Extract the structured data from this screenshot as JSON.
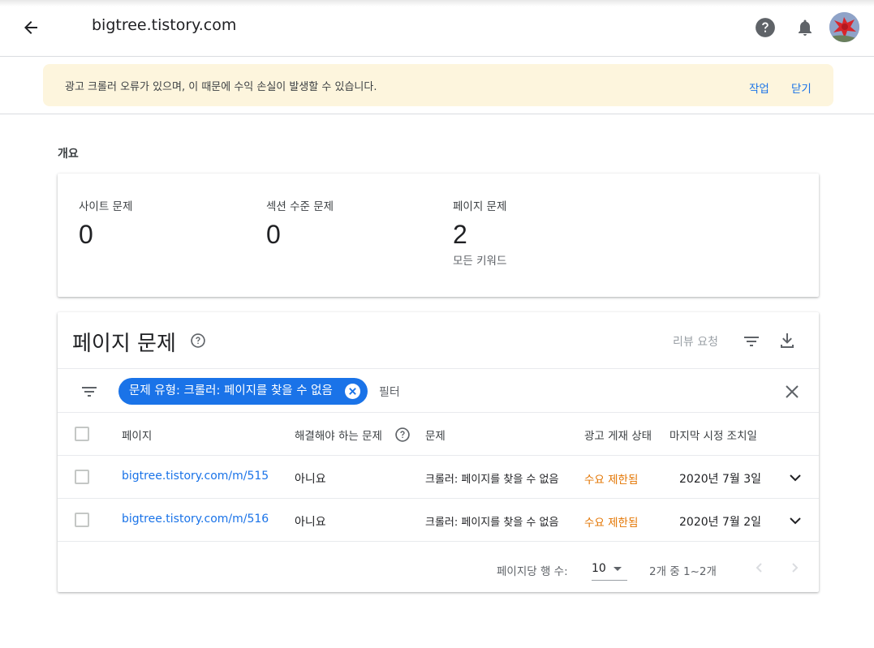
{
  "header": {
    "site": "bigtree.tistory.com",
    "back_icon": "arrow-back-icon",
    "help_icon": "help-icon",
    "notifications_icon": "bell-icon"
  },
  "banner": {
    "message": "광고 크롤러 오류가 있으며, 이 때문에 수익 손실이 발생할 수 있습니다.",
    "action": "작업",
    "dismiss": "닫기",
    "background": "#fdf5dd"
  },
  "overview": {
    "heading": "개요",
    "stats": [
      {
        "label": "사이트 문제",
        "value": "0",
        "sub": ""
      },
      {
        "label": "섹션 수준 문제",
        "value": "0",
        "sub": ""
      },
      {
        "label": "페이지 문제",
        "value": "2",
        "sub": "모든 키워드"
      }
    ]
  },
  "issues": {
    "title": "페이지 문제",
    "review_request": "리뷰 요청",
    "filter_chip": "문제 유형: 크롤러: 페이지를 찾을 수 없음",
    "filter_placeholder": "필터",
    "columns": [
      "페이지",
      "해결해야 하는 문제",
      "문제",
      "광고 게재 상태",
      "마지막 시정 조치일"
    ],
    "rows": [
      {
        "page": "bigtree.tistory.com/m/515",
        "must_fix": "아니요",
        "issue": "크롤러: 페이지를 찾을 수 없음",
        "status": "수요 제한됨",
        "date": "2020년 7월 3일"
      },
      {
        "page": "bigtree.tistory.com/m/516",
        "must_fix": "아니요",
        "issue": "크롤러: 페이지를 찾을 수 없음",
        "status": "수요 제한됨",
        "date": "2020년 7월 2일"
      }
    ],
    "pager": {
      "rows_label": "페이지당 행 수:",
      "rows_value": "10",
      "range": "2개 중 1~2개"
    }
  },
  "colors": {
    "accent": "#1a73e8",
    "status_warning": "#e37400"
  }
}
